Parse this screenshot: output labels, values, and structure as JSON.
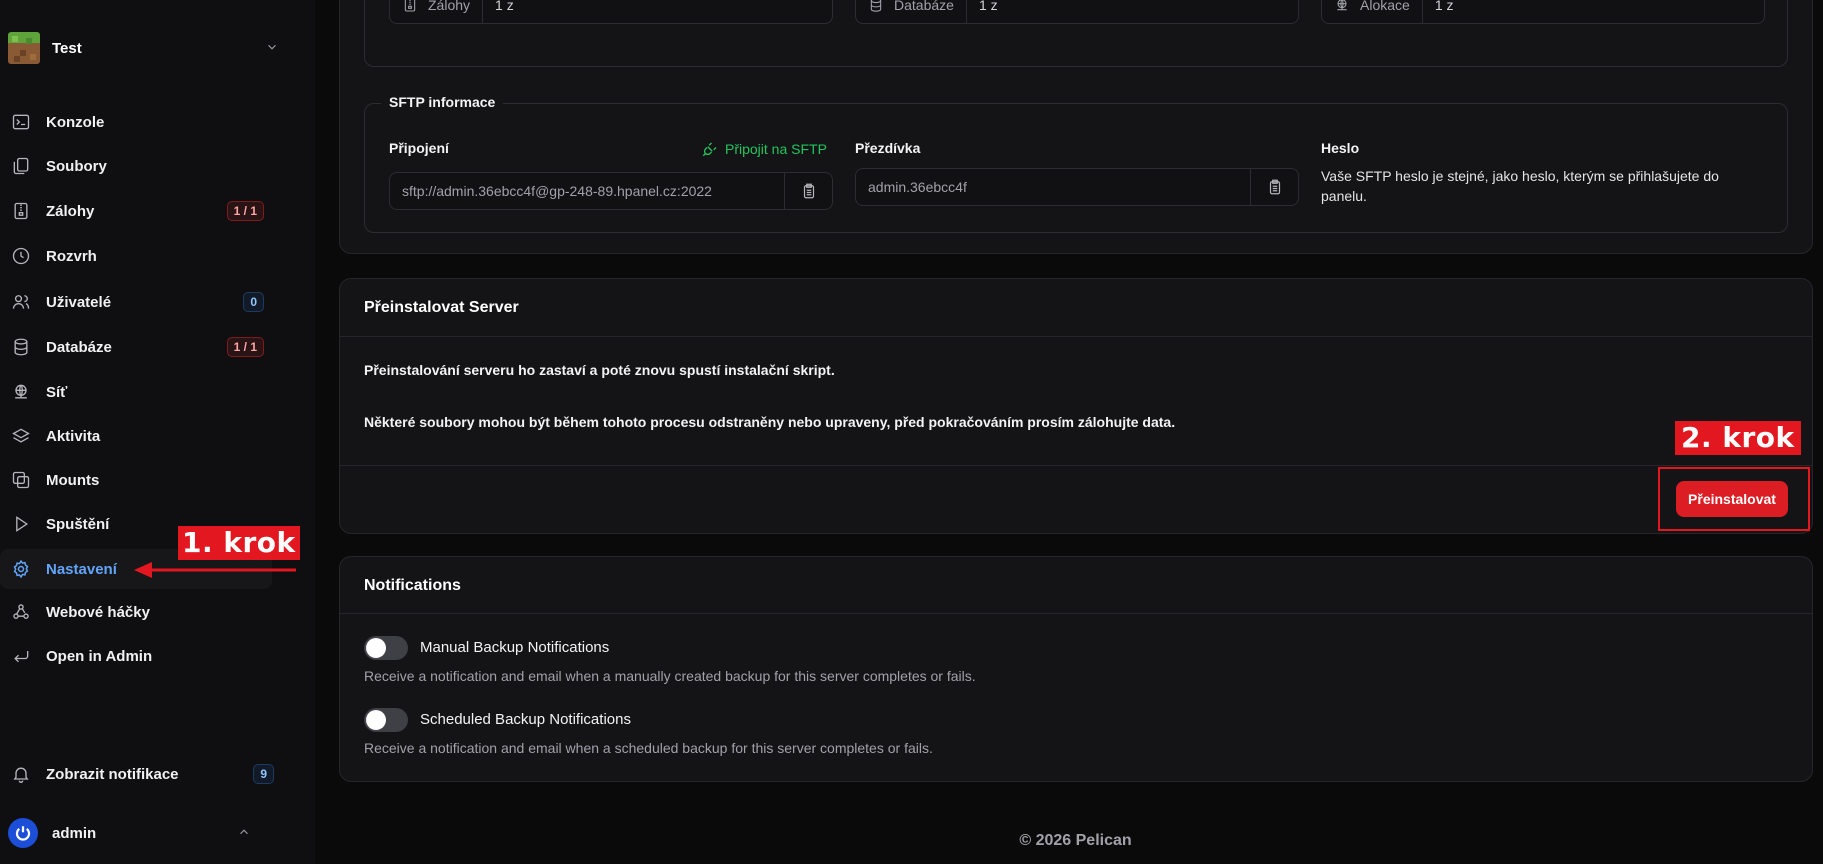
{
  "sidebar": {
    "server_name": "Test",
    "items": [
      {
        "label": "Konzole",
        "icon": "terminal-icon"
      },
      {
        "label": "Soubory",
        "icon": "files-icon"
      },
      {
        "label": "Zálohy",
        "icon": "archive-icon",
        "badge": "1 / 1"
      },
      {
        "label": "Rozvrh",
        "icon": "clock-icon"
      },
      {
        "label": "Uživatelé",
        "icon": "users-icon",
        "badge": "0"
      },
      {
        "label": "Databáze",
        "icon": "database-icon",
        "badge": "1 / 1"
      },
      {
        "label": "Síť",
        "icon": "network-icon"
      },
      {
        "label": "Aktivita",
        "icon": "stack-icon"
      },
      {
        "label": "Mounts",
        "icon": "mounts-icon"
      },
      {
        "label": "Spuštění",
        "icon": "play-icon"
      },
      {
        "label": "Nastavení",
        "icon": "gear-icon",
        "active": true
      },
      {
        "label": "Webové háčky",
        "icon": "webhook-icon"
      },
      {
        "label": "Open in Admin",
        "icon": "return-icon"
      }
    ],
    "notifications_label": "Zobrazit notifikace",
    "notifications_count": "9",
    "user_name": "admin"
  },
  "annotations": {
    "step1": "1. krok",
    "step2": "2. krok",
    "accent_color": "#e3171f"
  },
  "limits": {
    "backups_label": "Zálohy",
    "backups_value": "1 z",
    "databases_label": "Databáze",
    "databases_value": "1 z",
    "allocations_label": "Alokace",
    "allocations_value": "1 z"
  },
  "sftp": {
    "legend": "SFTP informace",
    "connection_label": "Připojení",
    "connect_link": "Připojit na SFTP",
    "connection_value": "sftp://admin.36ebcc4f@gp-248-89.hpanel.cz:2022",
    "username_label": "Přezdívka",
    "username_value": "admin.36ebcc4f",
    "password_label": "Heslo",
    "password_note": "Vaše SFTP heslo je stejné, jako heslo, kterým se přihlašujete do panelu."
  },
  "reinstall": {
    "title": "Přeinstalovat Server",
    "line1": "Přeinstalování serveru ho zastaví a poté znovu spustí instalační skript.",
    "line2": "Některé soubory mohou být během tohoto procesu odstraněny nebo upraveny, před pokračováním prosím zálohujte data.",
    "button": "Přeinstalovat"
  },
  "notifications": {
    "title": "Notifications",
    "manual_label": "Manual Backup Notifications",
    "manual_desc": "Receive a notification and email when a manually created backup for this server completes or fails.",
    "manual_enabled": false,
    "scheduled_label": "Scheduled Backup Notifications",
    "scheduled_desc": "Receive a notification and email when a scheduled backup for this server completes or fails.",
    "scheduled_enabled": false
  },
  "footer": "© 2026 Pelican"
}
